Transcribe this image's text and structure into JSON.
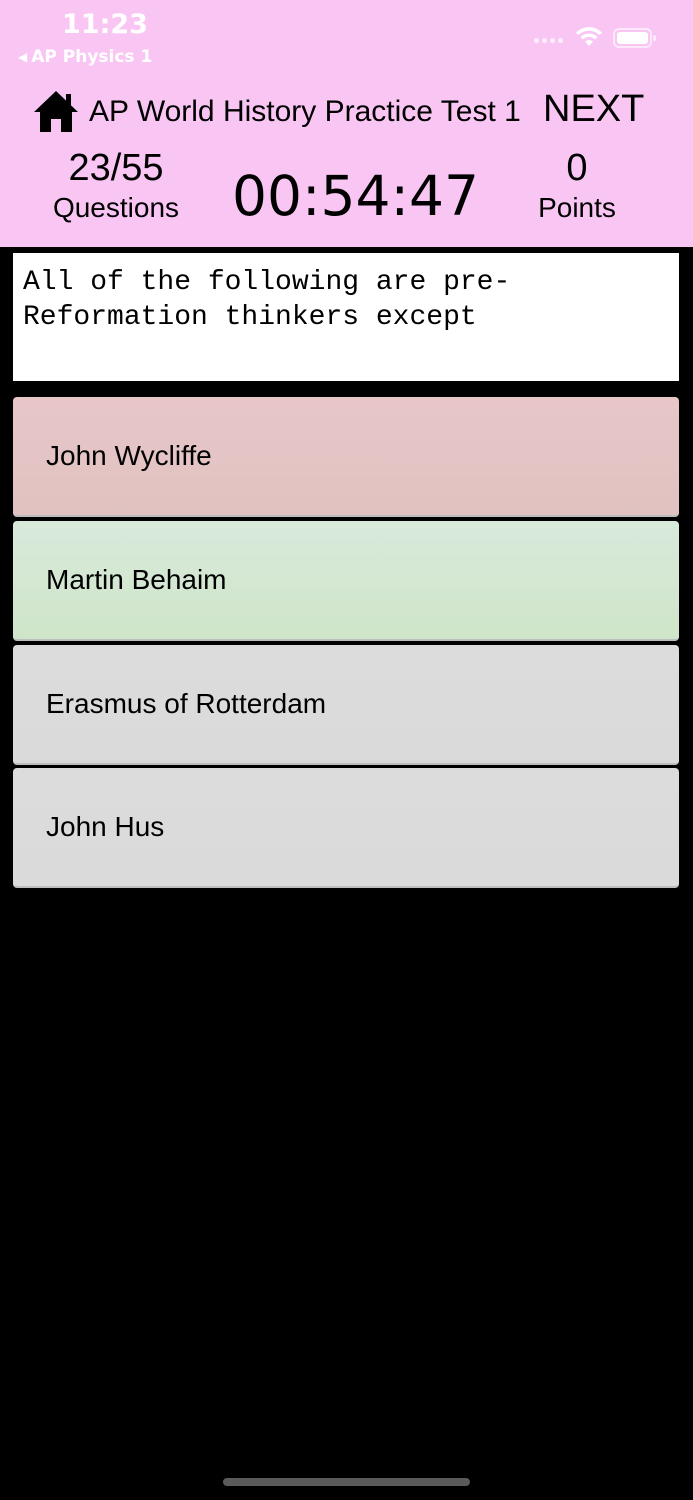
{
  "status_bar": {
    "time": "11:23",
    "back_label": "AP Physics 1",
    "wifi_icon": "wifi-icon",
    "battery_icon": "battery-icon"
  },
  "header": {
    "home_icon": "home-icon",
    "title": "AP World History Practice Test 1",
    "next_label": "NEXT",
    "background_color": "#f9c6f4",
    "progress": {
      "value": "23/55",
      "label": "Questions"
    },
    "timer": "00:54:47",
    "points": {
      "value": "0",
      "label": "Points"
    }
  },
  "question": {
    "text": "All of the following are pre-Reformation thinkers except"
  },
  "answers": [
    {
      "label": "John Wycliffe",
      "state": "incorrect",
      "color": "#e4c2c2"
    },
    {
      "label": "Martin Behaim",
      "state": "correct",
      "color": "#d2e8cc"
    },
    {
      "label": "Erasmus of Rotterdam",
      "state": "neutral",
      "color": "#dadada"
    },
    {
      "label": "John Hus",
      "state": "neutral",
      "color": "#dadada"
    }
  ]
}
